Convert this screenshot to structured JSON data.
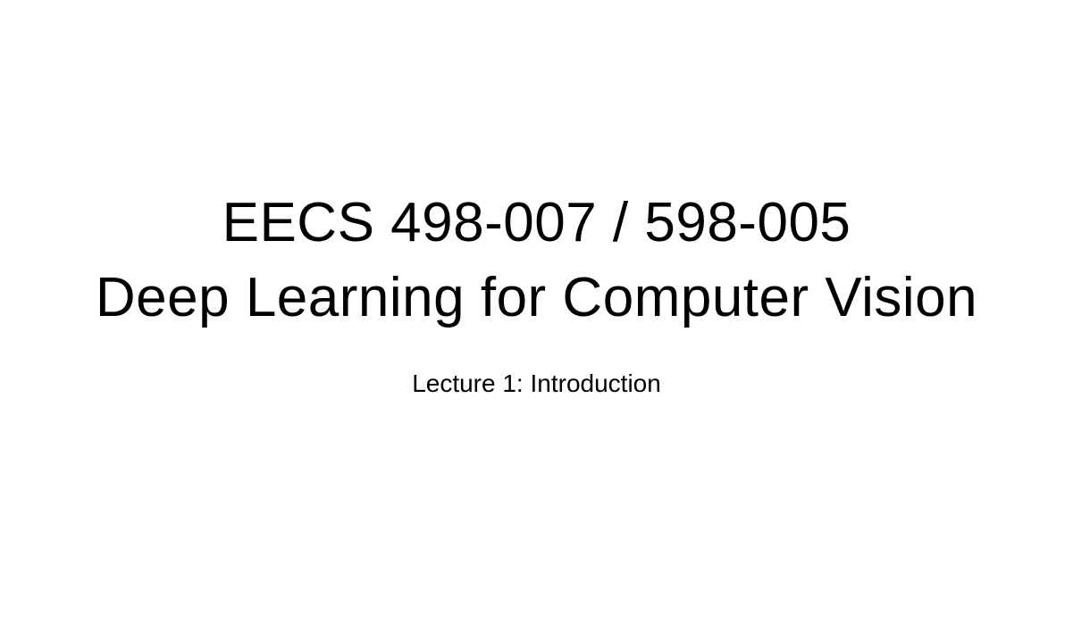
{
  "slide": {
    "title_line_1": "EECS 498-007 / 598-005",
    "title_line_2": "Deep Learning for Computer Vision",
    "subtitle": "Lecture 1: Introduction"
  }
}
